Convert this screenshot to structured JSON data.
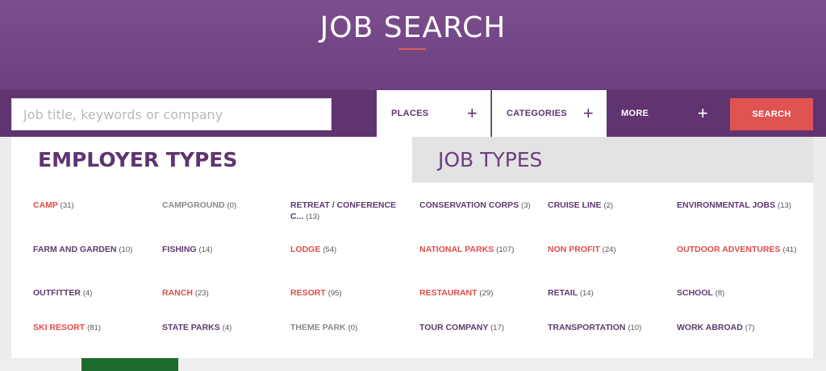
{
  "hero": {
    "title": "JOB SEARCH"
  },
  "search": {
    "placeholder": "Job title, keywords or company",
    "button": "SEARCH"
  },
  "filters": [
    {
      "label": "PLACES",
      "icon": "plus-icon"
    },
    {
      "label": "CATEGORIES",
      "icon": "plus-icon"
    },
    {
      "label": "MORE",
      "icon": "plus-icon"
    }
  ],
  "tabs": {
    "employer": "EMPLOYER TYPES",
    "job": "JOB TYPES"
  },
  "employer_types": [
    {
      "name": "CAMP",
      "count": "(31)",
      "color": "red"
    },
    {
      "name": "CAMPGROUND",
      "count": "(0)",
      "color": "gray"
    },
    {
      "name": "RETREAT / CONFERENCE C...",
      "count": "(13)",
      "color": "purple"
    },
    {
      "name": "CONSERVATION CORPS",
      "count": "(3)",
      "color": "purple"
    },
    {
      "name": "CRUISE LINE",
      "count": "(2)",
      "color": "purple"
    },
    {
      "name": "ENVIRONMENTAL JOBS",
      "count": "(13)",
      "color": "purple"
    },
    {
      "name": "FARM AND GARDEN",
      "count": "(10)",
      "color": "purple"
    },
    {
      "name": "FISHING",
      "count": "(14)",
      "color": "purple"
    },
    {
      "name": "LODGE",
      "count": "(54)",
      "color": "red"
    },
    {
      "name": "NATIONAL PARKS",
      "count": "(107)",
      "color": "red"
    },
    {
      "name": "NON PROFIT",
      "count": "(24)",
      "color": "red"
    },
    {
      "name": "OUTDOOR ADVENTURES",
      "count": "(41)",
      "color": "red"
    },
    {
      "name": "OUTFITTER",
      "count": "(4)",
      "color": "purple"
    },
    {
      "name": "RANCH",
      "count": "(23)",
      "color": "red"
    },
    {
      "name": "RESORT",
      "count": "(95)",
      "color": "red"
    },
    {
      "name": "RESTAURANT",
      "count": "(29)",
      "color": "red"
    },
    {
      "name": "RETAIL",
      "count": "(14)",
      "color": "purple"
    },
    {
      "name": "SCHOOL",
      "count": "(8)",
      "color": "purple"
    },
    {
      "name": "SKI RESORT",
      "count": "(81)",
      "color": "red"
    },
    {
      "name": "STATE PARKS",
      "count": "(4)",
      "color": "purple"
    },
    {
      "name": "THEME PARK",
      "count": "(0)",
      "color": "gray"
    },
    {
      "name": "TOUR COMPANY",
      "count": "(17)",
      "color": "purple"
    },
    {
      "name": "TRANSPORTATION",
      "count": "(10)",
      "color": "purple"
    },
    {
      "name": "WORK ABROAD",
      "count": "(7)",
      "color": "purple"
    }
  ],
  "colors": {
    "brand": "#6c3f80",
    "accent": "#df5350",
    "purple_text": "#5d3a6f",
    "gray_text": "#8a8a8a"
  }
}
